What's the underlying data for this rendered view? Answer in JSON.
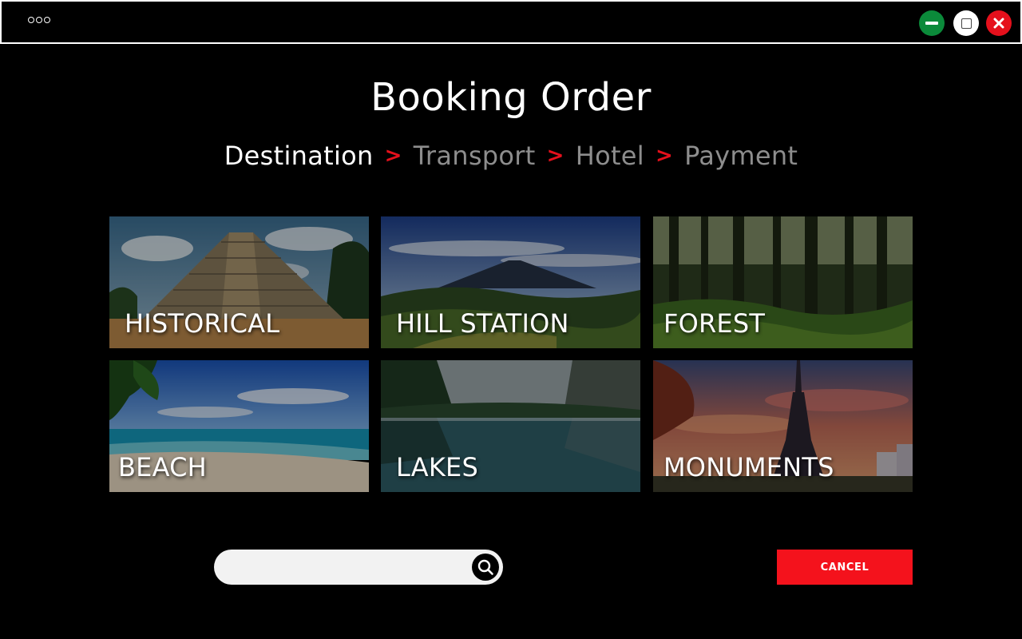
{
  "window": {
    "menu_icon": "more-dots-icon",
    "minimize_icon": "minimize-icon",
    "maximize_icon": "maximize-icon",
    "close_icon": "close-icon",
    "colors": {
      "minimize": "#0b8a3a",
      "maximize": "#ffffff",
      "close": "#e5101c"
    }
  },
  "page": {
    "title": "Booking Order"
  },
  "steps": [
    {
      "label": "Destination",
      "active": true
    },
    {
      "label": "Transport",
      "active": false
    },
    {
      "label": "Hotel",
      "active": false
    },
    {
      "label": "Payment",
      "active": false
    }
  ],
  "step_separator": ">",
  "categories": [
    {
      "label": "HISTORICAL"
    },
    {
      "label": "HILL STATION"
    },
    {
      "label": "FOREST"
    },
    {
      "label": "BEACH"
    },
    {
      "label": "LAKES"
    },
    {
      "label": "MONUMENTS"
    }
  ],
  "search": {
    "value": "",
    "placeholder": "",
    "icon": "search-icon"
  },
  "actions": {
    "cancel_label": "CANCEL"
  },
  "colors": {
    "accent": "#f4121c",
    "inactive_step": "#8d8d8d",
    "background": "#000000"
  }
}
